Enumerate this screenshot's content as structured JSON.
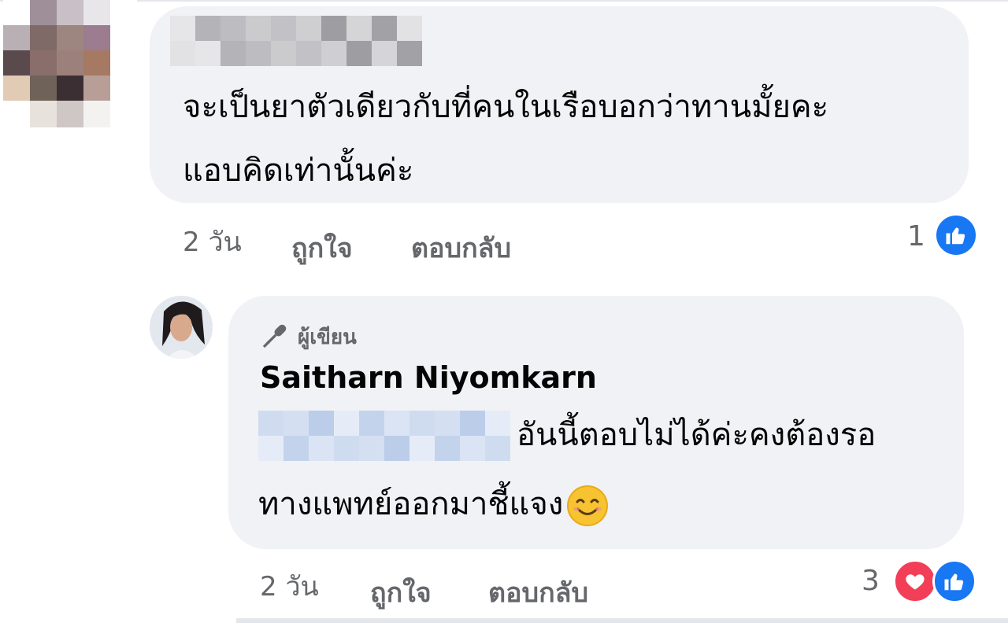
{
  "comment1": {
    "text_line1": "จะเป็นยาตัวเดียวกับที่คนในเรือบอกว่าทานมั้ยคะ",
    "text_line2": "แอบคิดเท่านั้นค่ะ",
    "time": "2 วัน",
    "like_label": "ถูกใจ",
    "reply_label": "ตอบกลับ",
    "reaction_count": "1",
    "reactions": [
      "like-icon"
    ]
  },
  "comment2": {
    "badge_icon": "microphone-icon",
    "badge_label": "ผู้เขียน",
    "author": "Saitharn Niyomkarn",
    "text_line1": "อันนี้ตอบไม่ได้ค่ะคงต้องรอ",
    "text_line2": "ทางแพทย์ออกมาชี้แจง",
    "emoji": "smiling-face-icon",
    "time": "2 วัน",
    "like_label": "ถูกใจ",
    "reply_label": "ตอบกลับ",
    "reaction_count": "3",
    "reactions": [
      "heart-icon",
      "like-icon"
    ]
  },
  "colors": {
    "bubble": "#f0f2f5",
    "meta": "#65676b",
    "like_blue": "#1877f2",
    "love_red": "#f33e58"
  }
}
